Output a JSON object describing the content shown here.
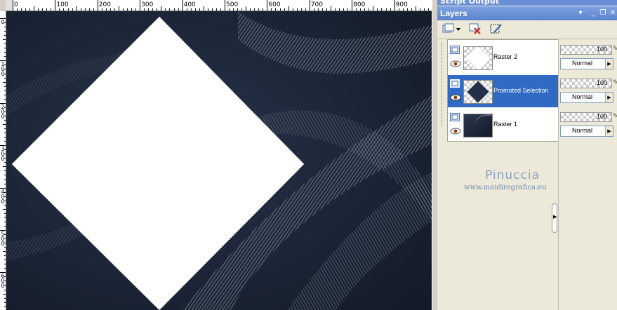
{
  "canvas": {
    "ruler_labels": [
      "0",
      "100",
      "200",
      "300",
      "400",
      "500",
      "600",
      "700",
      "800",
      "900"
    ],
    "vruler_labels": [
      "0",
      "1\n0\n0",
      "2\n0\n0",
      "3\n0\n0",
      "4\n0\n0",
      "5\n0\n0",
      "6\n0\n0"
    ]
  },
  "script_output": {
    "title": "Script Output"
  },
  "layers_panel": {
    "title": "Layers",
    "title_buttons": [
      "pin-icon",
      "minimize-icon",
      "restore-icon",
      "close-icon"
    ],
    "toolbar": [
      "new-layer-icon",
      "delete-layer-icon",
      "edit-selection-icon"
    ],
    "layers": [
      {
        "name": "Raster 2",
        "selected": false,
        "opacity": "100",
        "blend_mode": "Normal"
      },
      {
        "name": "Promoted Selection",
        "selected": true,
        "opacity": "100",
        "blend_mode": "Normal"
      },
      {
        "name": "Raster 1",
        "selected": false,
        "opacity": "100",
        "blend_mode": "Normal"
      }
    ]
  },
  "watermark": {
    "name": "Pinuccia",
    "url": "www.maidiregrafica.eu"
  },
  "colors": {
    "selection": "#316ac5",
    "titlebar": "#6a8fd6",
    "canvas_bg": "#1c2636"
  }
}
